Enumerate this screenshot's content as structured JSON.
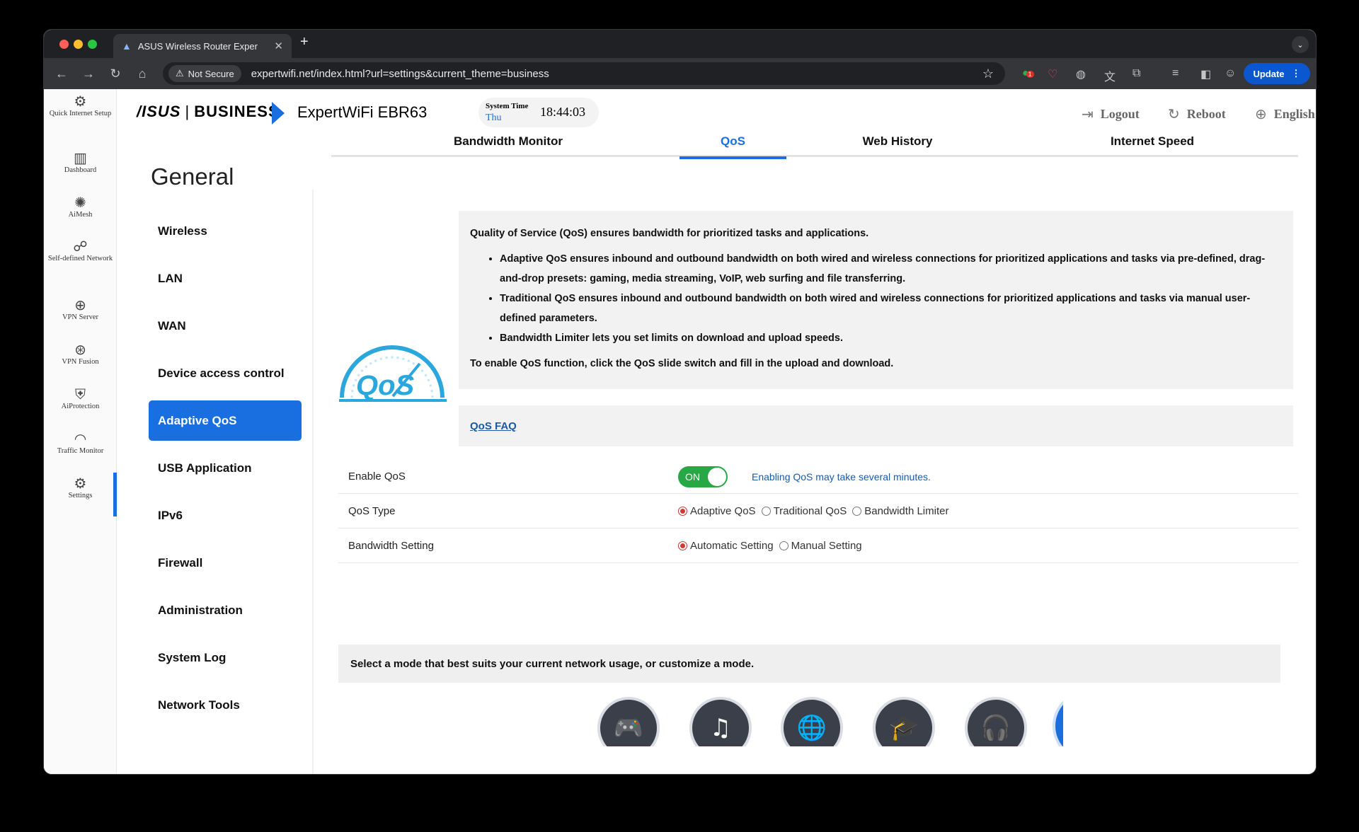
{
  "browser": {
    "tab_title": "ASUS Wireless Router Exper",
    "new_tab": "+",
    "tab_close": "✕",
    "security": "Not Secure",
    "url": "expertwifi.net/index.html?url=settings&current_theme=business",
    "update_label": "Update",
    "badge": "1"
  },
  "left_nav": [
    {
      "label": "Quick Internet Setup",
      "icon": "globe-setup-icon",
      "glyph": "⚙"
    },
    {
      "label": "Dashboard",
      "icon": "dashboard-icon",
      "glyph": "▥"
    },
    {
      "label": "AiMesh",
      "icon": "aimesh-icon",
      "glyph": "✺"
    },
    {
      "label": "Self-defined Network",
      "icon": "network-icon",
      "glyph": "☍"
    },
    {
      "label": "VPN Server",
      "icon": "vpn-server-icon",
      "glyph": "⊕"
    },
    {
      "label": "VPN Fusion",
      "icon": "vpn-fusion-icon",
      "glyph": "⊛"
    },
    {
      "label": "AiProtection",
      "icon": "shield-icon",
      "glyph": "⛨"
    },
    {
      "label": "Traffic Monitor",
      "icon": "traffic-icon",
      "glyph": "◠"
    },
    {
      "label": "Settings",
      "icon": "settings-icon",
      "glyph": "⚙"
    }
  ],
  "header": {
    "logo_asus": "/ISUS",
    "logo_sep": "|",
    "logo_business": "BUSINESS",
    "model": "ExpertWiFi EBR63",
    "system_time_label": "System Time",
    "day": "Thu",
    "time": "18:44:03",
    "logout": "Logout",
    "reboot": "Reboot",
    "language": "English"
  },
  "subnav": {
    "title": "General",
    "items": [
      "Wireless",
      "LAN",
      "WAN",
      "Device access control",
      "Adaptive QoS",
      "USB Application",
      "IPv6",
      "Firewall",
      "Administration",
      "System Log",
      "Network Tools"
    ],
    "active": "Adaptive QoS"
  },
  "tabs": [
    "Bandwidth Monitor",
    "QoS",
    "Web History",
    "Internet Speed"
  ],
  "active_tab": "QoS",
  "info": {
    "intro": "Quality of Service (QoS) ensures bandwidth for prioritized tasks and applications.",
    "bullets": [
      "Adaptive QoS ensures inbound and outbound bandwidth on both wired and wireless connections for prioritized applications and tasks via pre-defined, drag-and-drop presets: gaming, media streaming, VoIP, web surfing and file transferring.",
      "Traditional QoS ensures inbound and outbound bandwidth on both wired and wireless connections for prioritized applications and tasks via manual user-defined parameters.",
      "Bandwidth Limiter lets you set limits on download and upload speeds."
    ],
    "footer": "To enable QoS function, click the QoS slide switch and fill in the upload and download.",
    "faq": "QoS FAQ",
    "image_text": "QoS"
  },
  "form": {
    "enable_label": "Enable QoS",
    "toggle": "ON",
    "enable_note": "Enabling QoS may take several minutes.",
    "type_label": "QoS Type",
    "type_options": [
      "Adaptive QoS",
      "Traditional QoS",
      "Bandwidth Limiter"
    ],
    "type_selected": "Adaptive QoS",
    "bw_label": "Bandwidth Setting",
    "bw_options": [
      "Automatic Setting",
      "Manual Setting"
    ],
    "bw_selected": "Automatic Setting"
  },
  "modes": {
    "prompt": "Select a mode that best suits your current network usage, or customize a mode.",
    "items": [
      {
        "name": "gaming-mode",
        "glyph": "🎮"
      },
      {
        "name": "media-streaming-mode",
        "glyph": "♫"
      },
      {
        "name": "web-surfing-mode",
        "glyph": "🌐"
      },
      {
        "name": "learn-from-home-mode",
        "glyph": "🎓"
      },
      {
        "name": "work-from-home-mode",
        "glyph": "🎧"
      },
      {
        "name": "customize-mode",
        "glyph": "⚙"
      }
    ],
    "selected": "customize-mode"
  },
  "colors": {
    "accent": "#1a6fe0",
    "toggle_on": "#28a745",
    "link": "#1a5aa8"
  }
}
